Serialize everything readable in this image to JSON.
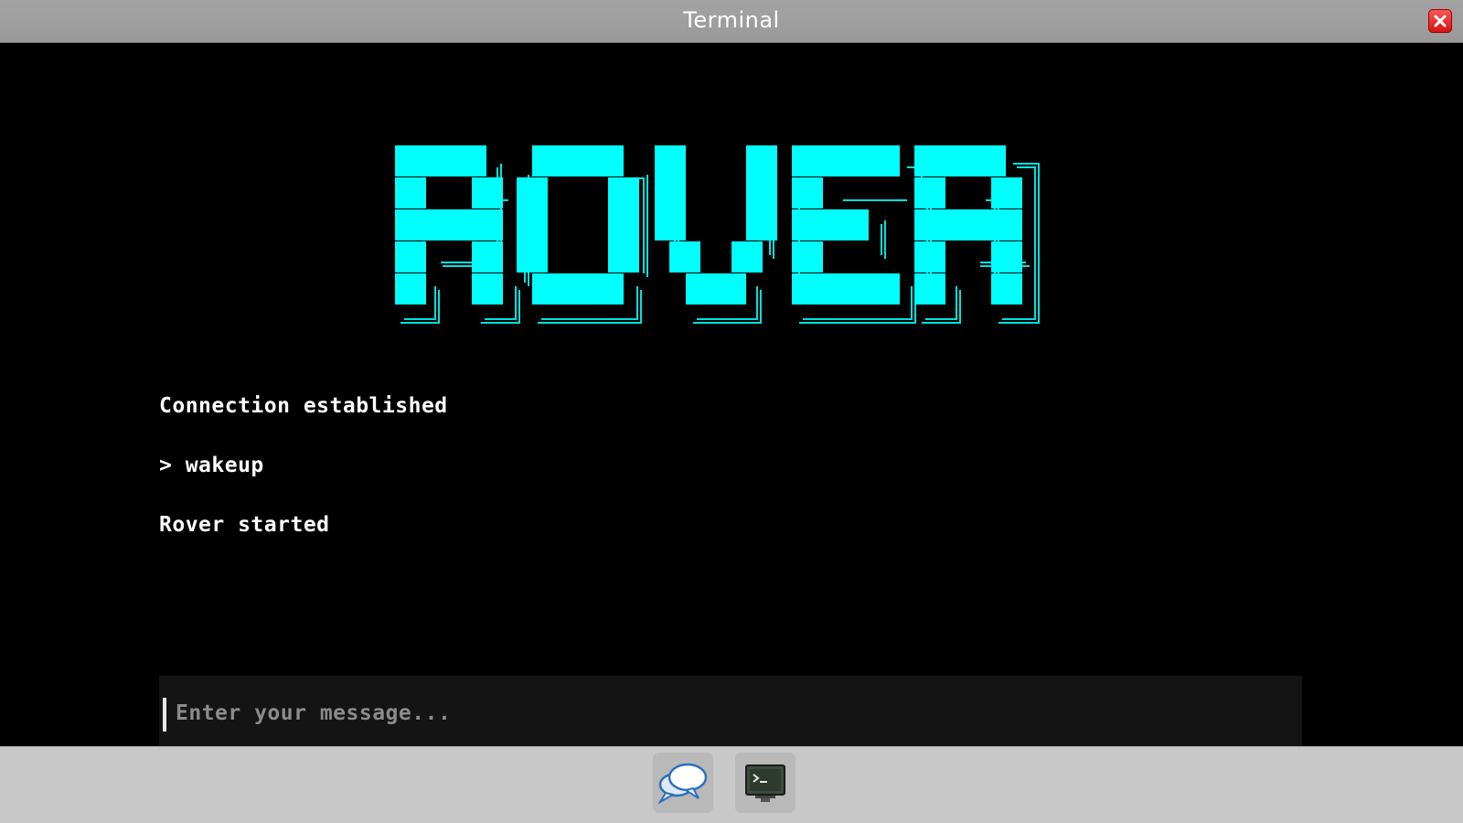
{
  "window": {
    "title": "Terminal",
    "close_icon": "close-icon"
  },
  "logo": {
    "text": "ROVER",
    "color": "#00ffff"
  },
  "terminal": {
    "lines": [
      "Connection established",
      "> wakeup",
      "Rover started"
    ],
    "input": {
      "value": "",
      "placeholder": "Enter your message..."
    }
  },
  "taskbar": {
    "apps": [
      {
        "name": "chat",
        "icon": "chat-bubbles-icon"
      },
      {
        "name": "terminal",
        "icon": "terminal-icon"
      }
    ]
  }
}
